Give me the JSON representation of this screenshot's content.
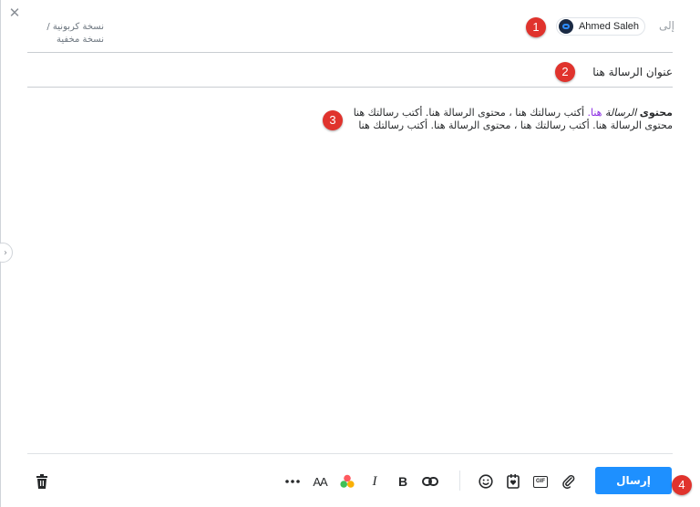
{
  "header": {
    "close_label": "✕",
    "cc_label": "نسخة كربونية /",
    "bcc_label": "نسخة مخفية",
    "to_label": "إلى",
    "recipient_name": "Ahmed Saleh"
  },
  "subject": "عنوان الرسالة هنا",
  "body": {
    "bold_part": "محتوى",
    "italic_part": "الرسالة",
    "highlight_part": "هنا.",
    "line1_rest": "أكتب رسالتك هنا ، محتوى الرسالة هنا. أكتب رسالتك هنا",
    "line2": "محتوى الرسالة هنا. أكتب رسالتك هنا ، محتوى الرسالة هنا. أكتب رسالتك هنا"
  },
  "markers": [
    "1",
    "2",
    "3",
    "4"
  ],
  "toolbar": {
    "send_label": "إرسال",
    "icons": [
      "delete-icon",
      "more-icon",
      "font-size-icon",
      "color-icon",
      "italic-icon",
      "bold-icon",
      "link-icon",
      "emoji-icon",
      "sticker-icon",
      "gif-icon",
      "attach-icon"
    ],
    "gif_text": "GIF",
    "font_text": "AA",
    "italic_text": "I",
    "bold_text": "B"
  },
  "colors": {
    "accent": "#1e90ff",
    "marker": "#e0332d",
    "highlight": "#8a2be2"
  }
}
